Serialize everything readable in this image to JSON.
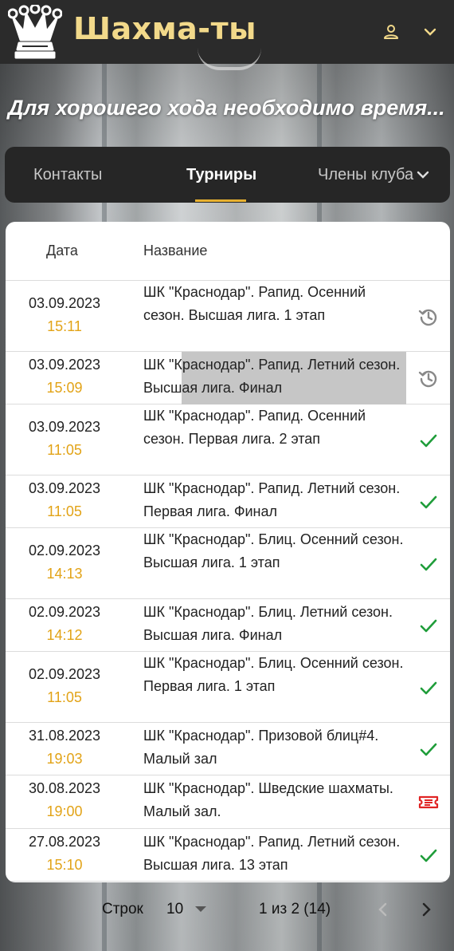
{
  "app": {
    "title": "Шахма-ты"
  },
  "header": {
    "logo_icon": "chess-queen-crown-icon",
    "user_icon": "user-icon",
    "menu_icon": "chevron-down-icon"
  },
  "tagline": "Для хорошего хода необходимо время...",
  "tabs": [
    {
      "label": "Контакты",
      "active": false
    },
    {
      "label": "Турниры",
      "active": true
    },
    {
      "label": "Члены клуба",
      "active": false
    }
  ],
  "table": {
    "columns": {
      "date": "Дата",
      "name": "Название"
    },
    "rows": [
      {
        "date": "03.09.2023",
        "time": "15:11",
        "name": "ШК \"Краснодар\". Рапид. Осенний сезон. Высшая лига. 1 этап",
        "status": "in-progress"
      },
      {
        "date": "03.09.2023",
        "time": "15:09",
        "name": "ШК \"Краснодар\". Рапид. Летний сезон. Высшая лига. Финал",
        "status": "in-progress"
      },
      {
        "date": "03.09.2023",
        "time": "11:05",
        "name": "ШК \"Краснодар\". Рапид. Осенний сезон. Первая лига. 2 этап",
        "status": "finished"
      },
      {
        "date": "03.09.2023",
        "time": "11:05",
        "name": "ШК \"Краснодар\". Рапид. Летний сезон. Первая лига. Финал",
        "status": "finished"
      },
      {
        "date": "02.09.2023",
        "time": "14:13",
        "name": "ШК \"Краснодар\". Блиц. Осенний сезон. Высшая лига. 1 этап",
        "status": "finished"
      },
      {
        "date": "02.09.2023",
        "time": "14:12",
        "name": "ШК \"Краснодар\". Блиц. Летний сезон. Высшая лига. Финал",
        "status": "finished"
      },
      {
        "date": "02.09.2023",
        "time": "11:05",
        "name": "ШК \"Краснодар\". Блиц. Осенний сезон. Первая лига. 1 этап",
        "status": "finished"
      },
      {
        "date": "31.08.2023",
        "time": "19:03",
        "name": "ШК \"Краснодар\". Призовой блиц#4. Малый зал",
        "status": "finished"
      },
      {
        "date": "30.08.2023",
        "time": "19:00",
        "name": "ШК \"Краснодар\". Шведские шахматы. Малый зал.",
        "status": "registration"
      },
      {
        "date": "27.08.2023",
        "time": "15:10",
        "name": "ШК \"Краснодар\". Рапид. Летний сезон. Высшая лига. 13 этап",
        "status": "finished"
      }
    ]
  },
  "pagination": {
    "rows_label": "Строк",
    "rows_per_page": "10",
    "info": "1 из 2 (14)"
  },
  "colors": {
    "accent": "#e8b130",
    "time": "#e2a317",
    "check": "#1f9d3a",
    "ticket": "#e02424",
    "history": "#888888"
  }
}
